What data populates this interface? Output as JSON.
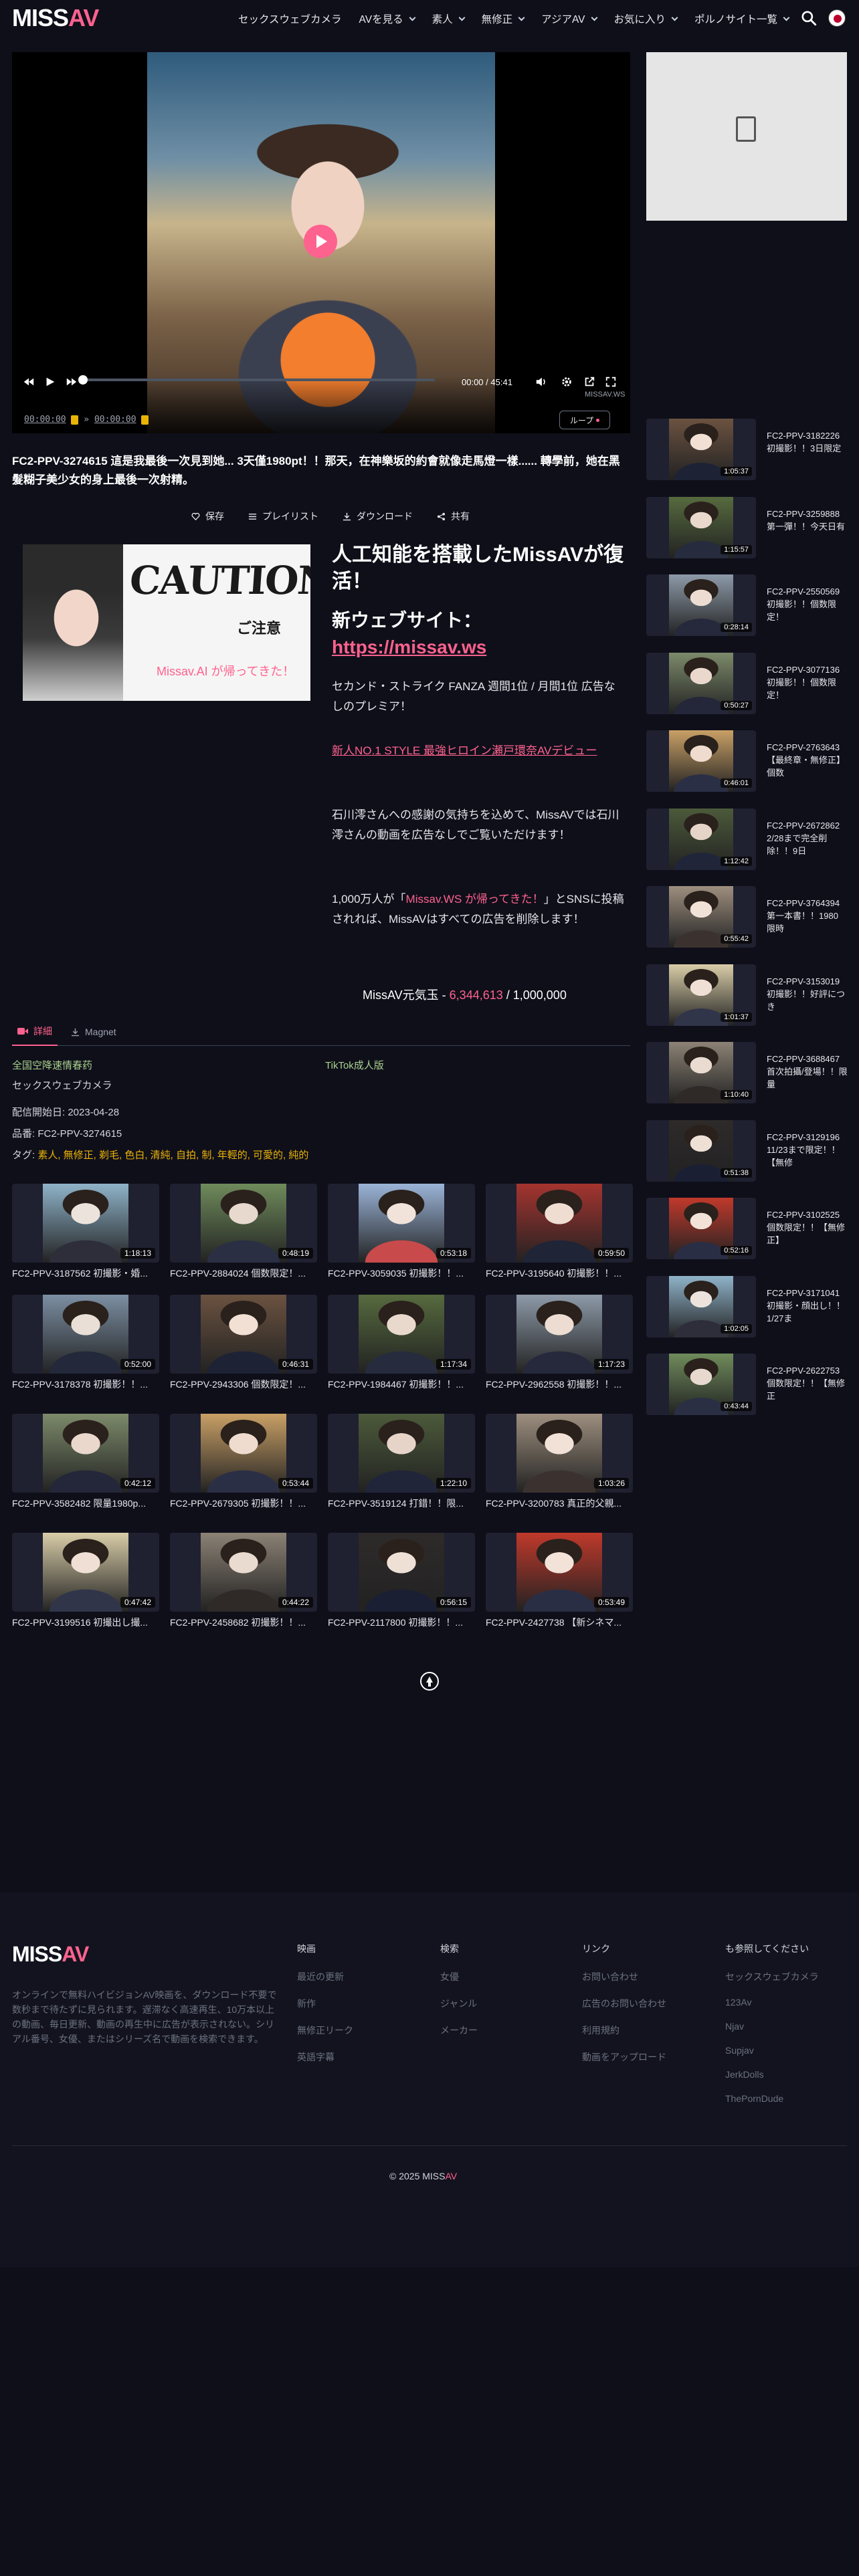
{
  "header": {
    "logo_a": "MISS",
    "logo_b": "AV",
    "nav": [
      {
        "label": "セックスウェブカメラ",
        "has_menu": false
      },
      {
        "label": "AVを見る",
        "has_menu": true
      },
      {
        "label": "素人",
        "has_menu": true
      },
      {
        "label": "無修正",
        "has_menu": true
      },
      {
        "label": "アジアAV",
        "has_menu": true
      },
      {
        "label": "お気に入り",
        "has_menu": true
      },
      {
        "label": "ポルノサイト一覧",
        "has_menu": true
      }
    ]
  },
  "player": {
    "time_current": "00:00",
    "time_separator": "/",
    "time_total": "45:41",
    "watermark": "MISSAV.WS",
    "loop_label": "ループ",
    "ab_start": "00:00:00",
    "ab_end": "00:00:00",
    "ab_arrow": "»"
  },
  "video": {
    "title": "FC2-PPV-3274615 這是我最後一次見到她... 3天僅1980pt！！那天，在神樂坂的約會就像走馬燈一樣...... 轉學前，她在黑髮糊子美少女的身上最後一次射精。",
    "actions": {
      "save": "保存",
      "playlist": "プレイリスト",
      "download": "ダウンロード",
      "share": "共有"
    }
  },
  "promo": {
    "image_caution": "CAUTION!",
    "image_chuui": "ご注意",
    "image_back": "Missav.AI が帰ってきた！",
    "heading": "人工知能を搭載したMissAVが復活！",
    "new_site_label": "新ウェブサイト：",
    "new_site_link": "https://missav.ws",
    "para1": "セカンド・ストライク FANZA 週間1位 / 月間1位 広告なしのプレミア！",
    "link_text": "新人NO.1 STYLE 最強ヒロイン瀬戸環奈AVデビュー",
    "para2": "石川澪さんへの感謝の気持ちを込めて、MissAVでは石川澪さんの動画を広告なしでご覧いただけます！",
    "para3_a": "1,000万人が「",
    "para3_highlight": "Missav.WS が帰ってきた！",
    "para3_b": "」とSNSに投稿されれば、MissAVはすべての広告を削除します！",
    "counter_label": "MissAV元気玉 - ",
    "counter_value": "6,344,613",
    "counter_total": " / 1,000,000"
  },
  "tabs": {
    "details": "詳細",
    "magnet": "Magnet"
  },
  "details": {
    "ad_link_left": "全国空降速情春药",
    "ad_link_right": "TikTok成人版",
    "link_3": "セックスウェブカメラ",
    "release_label": "配信開始日: ",
    "release_date": "2023-04-28",
    "code_label": "品番: ",
    "code": "FC2-PPV-3274615",
    "tags_label": "タグ: ",
    "tags": "素人, 無修正, 剃毛, 色白, 清純, 自拍, 制, 年輕的, 可愛的, 純的"
  },
  "grid": [
    {
      "title": "FC2-PPV-3187562 初撮影・婚...",
      "duration": "1:18:13"
    },
    {
      "title": "FC2-PPV-2884024 個数限定！...",
      "duration": "0:48:19"
    },
    {
      "title": "FC2-PPV-3059035 初撮影！！...",
      "duration": "0:53:18"
    },
    {
      "title": "FC2-PPV-3195640 初撮影！！...",
      "duration": "0:59:50"
    },
    {
      "title": "FC2-PPV-3178378 初撮影！！...",
      "duration": "0:52:00"
    },
    {
      "title": "FC2-PPV-2943306 個数限定！...",
      "duration": "0:46:31"
    },
    {
      "title": "FC2-PPV-1984467 初撮影！！...",
      "duration": "1:17:34"
    },
    {
      "title": "FC2-PPV-2962558 初撮影！！...",
      "duration": "1:17:23"
    },
    {
      "title": "FC2-PPV-3582482 限量1980p...",
      "duration": "0:42:12"
    },
    {
      "title": "FC2-PPV-2679305 初撮影！！...",
      "duration": "0:53:44"
    },
    {
      "title": "FC2-PPV-3519124 打錯！！限...",
      "duration": "1:22:10"
    },
    {
      "title": "FC2-PPV-3200783 真正的父親...",
      "duration": "1:03:26"
    },
    {
      "title": "FC2-PPV-3199516 初撮出し撮...",
      "duration": "0:47:42"
    },
    {
      "title": "FC2-PPV-2458682 初撮影！！...",
      "duration": "0:44:22"
    },
    {
      "title": "FC2-PPV-2117800 初撮影！！...",
      "duration": "0:56:15"
    },
    {
      "title": "FC2-PPV-2427738 【新シネマ...",
      "duration": "0:53:49"
    }
  ],
  "sidebar": [
    {
      "title": "FC2-PPV-3182226 初撮影！！3日限定",
      "duration": "1:05:37"
    },
    {
      "title": "FC2-PPV-3259888 第一彈！！今天日有",
      "duration": "1:15:57"
    },
    {
      "title": "FC2-PPV-2550569 初撮影！！個数限定！",
      "duration": "0:28:14"
    },
    {
      "title": "FC2-PPV-3077136 初撮影！！個数限定！",
      "duration": "0:50:27"
    },
    {
      "title": "FC2-PPV-2763643 【最終章・無修正】個数",
      "duration": "0:46:01"
    },
    {
      "title": "FC2-PPV-2672862 2/28まで完全削除！！9日",
      "duration": "1:12:42"
    },
    {
      "title": "FC2-PPV-3764394 第一本書！！1980 限時",
      "duration": "0:55:42"
    },
    {
      "title": "FC2-PPV-3153019 初撮影！！好評につき",
      "duration": "1:01:37"
    },
    {
      "title": "FC2-PPV-3688467 首次拍攝/登場！！限量",
      "duration": "1:10:40"
    },
    {
      "title": "FC2-PPV-3129196 11/23まで限定！！【無修",
      "duration": "0:51:38"
    },
    {
      "title": "FC2-PPV-3102525 個数限定！！【無修正】",
      "duration": "0:52:16"
    },
    {
      "title": "FC2-PPV-3171041 初撮影・顔出し！！1/27ま",
      "duration": "1:02:05"
    },
    {
      "title": "FC2-PPV-2622753 個数限定！！【無修正",
      "duration": "0:43:44"
    }
  ],
  "footer": {
    "description": "オンラインで無料ハイビジョンAV映画を、ダウンロード不要で数秒まで待たずに見られます。遅滞なく高速再生、10万本以上の動画、毎日更新、動画の再生中に広告が表示されない。シリアル番号、女優、またはシリーズ名で動画を検索できます。",
    "columns": [
      {
        "heading": "映画",
        "links": [
          "最近の更新",
          "新作",
          "無修正リーク",
          "英語字幕"
        ]
      },
      {
        "heading": "検索",
        "links": [
          "女優",
          "ジャンル",
          "メーカー"
        ]
      },
      {
        "heading": "リンク",
        "links": [
          "お問い合わせ",
          "広告のお問い合わせ",
          "利用規約",
          "動画をアップロード"
        ]
      },
      {
        "heading": "も参照してください",
        "links": [
          "セックスウェブカメラ",
          "123Av",
          "Njav",
          "Supjav",
          "JerkDolls",
          "ThePornDude"
        ]
      }
    ],
    "copyright": "© 2025 "
  },
  "colors": {
    "accent": "#fe628e",
    "background": "#0f0f1a"
  }
}
